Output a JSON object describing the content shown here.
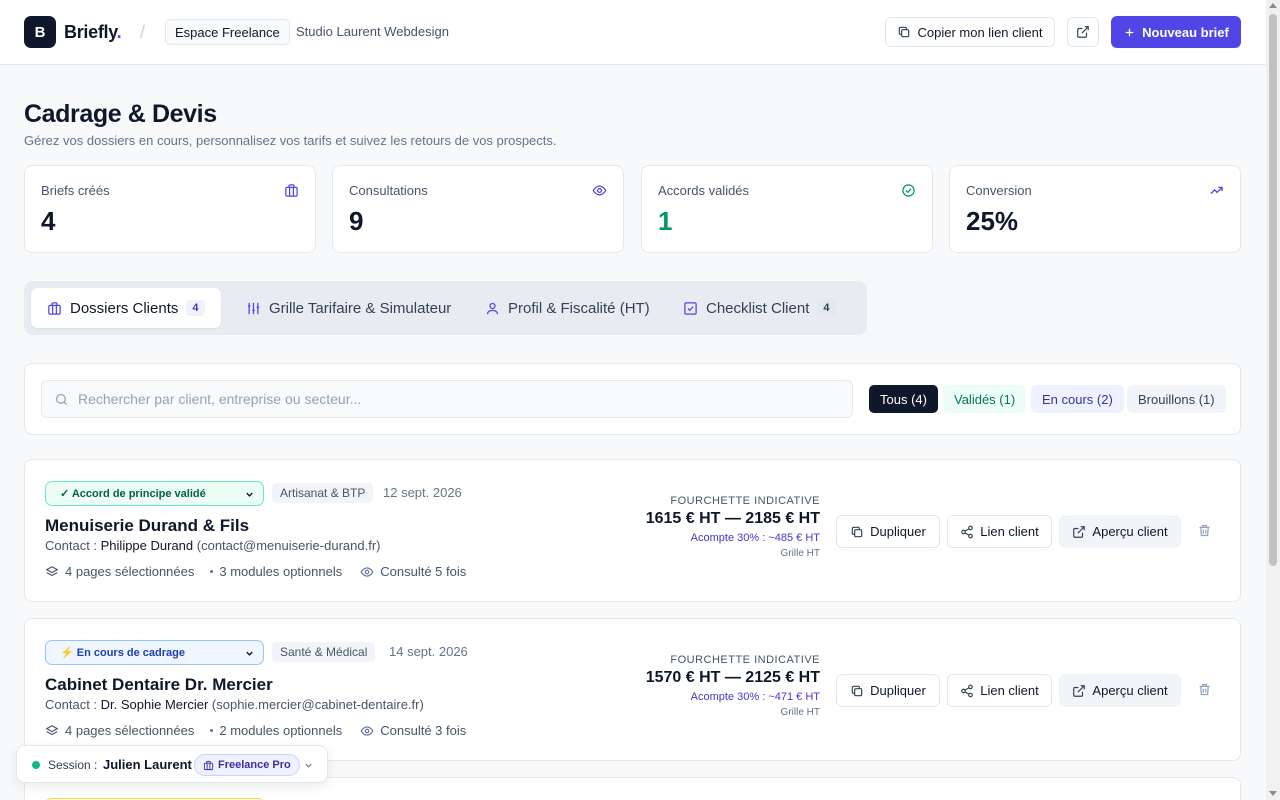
{
  "header": {
    "logo_letter": "B",
    "brand": "Briefly",
    "brand_dot": ".",
    "separator": "/",
    "space": "Espace Freelance",
    "studio": "Studio Laurent Webdesign",
    "copy_link": "Copier mon lien client",
    "new_brief": "Nouveau brief"
  },
  "page": {
    "title": "Cadrage & Devis",
    "subtitle": "Gérez vos dossiers en cours, personnalisez vos tarifs et suivez les retours de vos prospects."
  },
  "stats": [
    {
      "label": "Briefs créés",
      "value": "4",
      "icon": "briefcase-icon"
    },
    {
      "label": "Consultations",
      "value": "9",
      "icon": "eye-icon"
    },
    {
      "label": "Accords validés",
      "value": "1",
      "icon": "check-circle-icon"
    },
    {
      "label": "Conversion",
      "value": "25%",
      "icon": "trending-up-icon"
    }
  ],
  "colors": {
    "accent": "#4f46e5",
    "success": "#059669",
    "dark": "#0f172a"
  },
  "tabs": [
    {
      "label": "Dossiers Clients",
      "count": "4"
    },
    {
      "label": "Grille Tarifaire & Simulateur"
    },
    {
      "label": "Profil & Fiscalité (HT)"
    },
    {
      "label": "Checklist Client",
      "count": "4"
    }
  ],
  "search": {
    "placeholder": "Rechercher par client, entreprise ou secteur...",
    "value": ""
  },
  "filters": {
    "all": "Tous (4)",
    "validated": "Validés (1)",
    "in_progress": "En cours (2)",
    "drafts": "Brouillons (1)"
  },
  "clients": [
    {
      "status": "✓ Accord de principe validé",
      "sector": "Artisanat & BTP",
      "date": "12 sept. 2026",
      "name": "Menuiserie Durand & Fils",
      "contact_prefix": "Contact : ",
      "contact_name": "Philippe Durand",
      "contact_email": " (contact@menuiserie-durand.fr)",
      "pages": "4 pages sélectionnées",
      "modules": "3 modules optionnels",
      "views": "Consulté 5 fois",
      "price_label": "FOURCHETTE INDICATIVE",
      "price": "1615 € HT — 2185 € HT",
      "deposit": "Acompte 30% : ~485 € HT",
      "grid": "Grille HT"
    },
    {
      "status": "⚡ En cours de cadrage",
      "sector": "Santé & Médical",
      "date": "14 sept. 2026",
      "name": "Cabinet Dentaire Dr. Mercier",
      "contact_prefix": "Contact : ",
      "contact_name": "Dr. Sophie Mercier",
      "contact_email": " (sophie.mercier@cabinet-dentaire.fr)",
      "pages": "4 pages sélectionnées",
      "modules": "2 modules optionnels",
      "views": "Consulté 3 fois",
      "price_label": "FOURCHETTE INDICATIVE",
      "price": "1570 € HT — 2125 € HT",
      "deposit": "Acompte 30% : ~471 € HT",
      "grid": "Grille HT"
    }
  ],
  "card_actions": {
    "duplicate": "Dupliquer",
    "client_link": "Lien client",
    "preview": "Aperçu client"
  },
  "session": {
    "label": "Session :",
    "user": "Julien Laurent",
    "plan": "Freelance Pro"
  }
}
